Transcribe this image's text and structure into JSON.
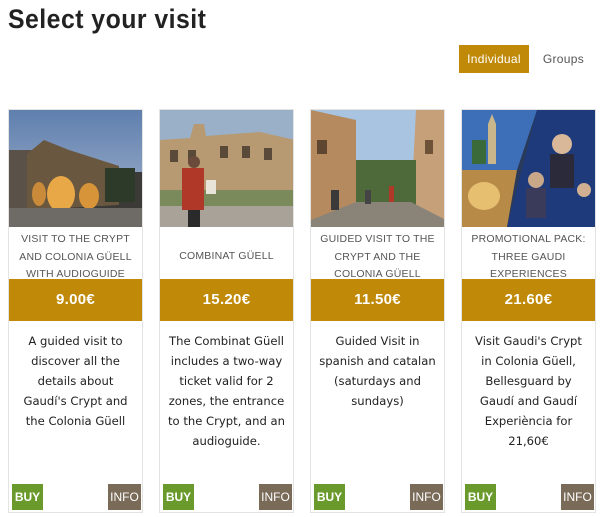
{
  "page": {
    "title": "Select your visit"
  },
  "tabs": [
    {
      "label": "Individual",
      "active": true
    },
    {
      "label": "Groups",
      "active": false
    }
  ],
  "cards": [
    {
      "title": "VISIT TO THE CRYPT AND COLONIA GÜELL WITH AUDIOGUIDE",
      "price": "9.00€",
      "description": "A guided visit to discover all the details about Gaudí's Crypt and the Colonia Güell",
      "buy_label": "BUY",
      "info_label": "INFO"
    },
    {
      "title": "COMBINAT GÜELL",
      "price": "15.20€",
      "description": "The Combinat Güell includes a two-way ticket valid for 2 zones, the entrance to the Crypt, and an audioguide.",
      "buy_label": "BUY",
      "info_label": "INFO"
    },
    {
      "title": "GUIDED VISIT TO THE CRYPT AND THE COLONIA GÜELL",
      "price": "11.50€",
      "description": "Guided Visit in spanish and catalan (saturdays and sundays)",
      "buy_label": "BUY",
      "info_label": "INFO"
    },
    {
      "title": "PROMOTIONAL PACK: THREE GAUDI EXPERIENCES",
      "price": "21.60€",
      "description": "Visit Gaudi's Crypt in Colonia Güell, Bellesguard by Gaudí and Gaudí Experiència for 21,60€",
      "buy_label": "BUY",
      "info_label": "INFO"
    }
  ],
  "colors": {
    "accent": "#c08a08",
    "buy": "#6a9a2c",
    "info": "#7a6a58"
  }
}
